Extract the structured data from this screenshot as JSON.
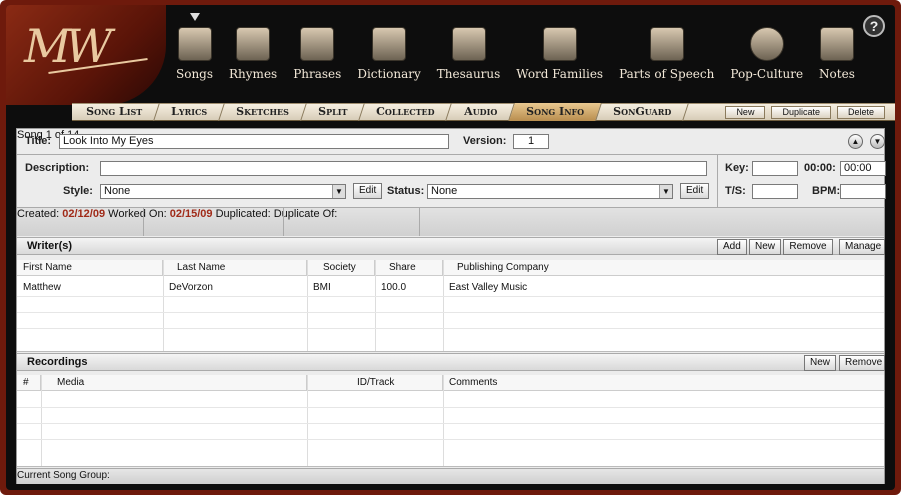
{
  "toolbar": {
    "items": [
      {
        "label": "Songs"
      },
      {
        "label": "Rhymes"
      },
      {
        "label": "Phrases"
      },
      {
        "label": "Dictionary"
      },
      {
        "label": "Thesaurus"
      },
      {
        "label": "Word Families"
      },
      {
        "label": "Parts of Speech"
      },
      {
        "label": "Pop-Culture"
      },
      {
        "label": "Notes"
      }
    ],
    "help": "?"
  },
  "tabs": [
    {
      "label": "Song List"
    },
    {
      "label": "Lyrics"
    },
    {
      "label": "Sketches"
    },
    {
      "label": "Split"
    },
    {
      "label": "Collected"
    },
    {
      "label": "Audio"
    },
    {
      "label": "Song Info",
      "active": true
    },
    {
      "label": "SonGuard"
    }
  ],
  "tab_actions": {
    "new": "New",
    "duplicate": "Duplicate",
    "delete": "Delete"
  },
  "song": {
    "title_label": "Title:",
    "title": "Look Into My Eyes",
    "version_label": "Version:",
    "version": "1",
    "counter": "Song 1 of 14",
    "description_label": "Description:",
    "description": "",
    "key_label": "Key:",
    "key": "",
    "time_label": "00:00:",
    "time": "00:00",
    "style_label": "Style:",
    "style": "None",
    "status_label": "Status:",
    "status": "None",
    "edit": "Edit",
    "ts_label": "T/S:",
    "ts": "",
    "bpm_label": "BPM:",
    "bpm": ""
  },
  "dates": {
    "created_label": "Created:",
    "created": "02/12/09",
    "worked_label": "Worked On:",
    "worked": "02/15/09",
    "duplicated_label": "Duplicated:",
    "duplicate_of_label": "Duplicate Of:"
  },
  "writers": {
    "title": "Writer(s)",
    "add": "Add",
    "new": "New",
    "remove": "Remove",
    "manage": "Manage",
    "columns": [
      "First Name",
      "Last Name",
      "Society",
      "Share",
      "Publishing Company"
    ],
    "rows": [
      [
        "Matthew",
        "DeVorzon",
        "BMI",
        "100.0",
        "East Valley Music"
      ]
    ]
  },
  "recordings": {
    "title": "Recordings",
    "new": "New",
    "remove": "Remove",
    "columns": [
      "#",
      "Media",
      "ID/Track",
      "Comments"
    ]
  },
  "footer": {
    "group_label": "Current Song Group:"
  }
}
